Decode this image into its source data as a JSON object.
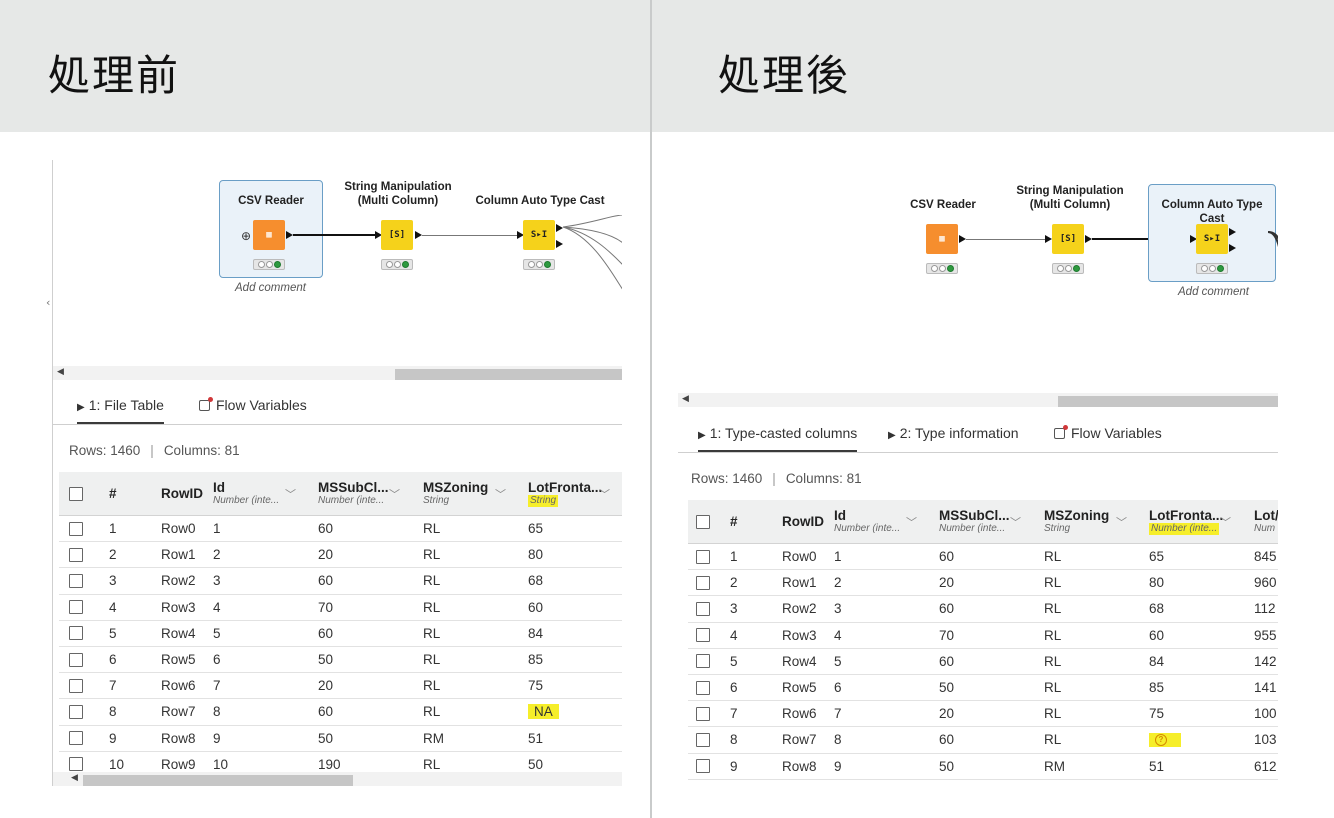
{
  "left": {
    "heading": "処理前",
    "nodes": {
      "csv_reader": "CSV Reader",
      "string_manip": "String Manipulation (Multi Column)",
      "auto_cast": "Column Auto Type Cast",
      "add_comment": "Add comment"
    },
    "tabs": [
      "1: File Table",
      "Flow Variables"
    ],
    "rows_label": "Rows: 1460",
    "cols_label": "Columns: 81",
    "headers": {
      "num": "#",
      "rowid": "RowID",
      "cols": [
        {
          "name": "Id",
          "type": "Number (inte..."
        },
        {
          "name": "MSSubCl...",
          "type": "Number (inte..."
        },
        {
          "name": "MSZoning",
          "type": "String"
        },
        {
          "name": "LotFronta...",
          "type": "String"
        }
      ]
    },
    "rows": [
      [
        "1",
        "Row0",
        "1",
        "60",
        "RL",
        "65"
      ],
      [
        "2",
        "Row1",
        "2",
        "20",
        "RL",
        "80"
      ],
      [
        "3",
        "Row2",
        "3",
        "60",
        "RL",
        "68"
      ],
      [
        "4",
        "Row3",
        "4",
        "70",
        "RL",
        "60"
      ],
      [
        "5",
        "Row4",
        "5",
        "60",
        "RL",
        "84"
      ],
      [
        "6",
        "Row5",
        "6",
        "50",
        "RL",
        "85"
      ],
      [
        "7",
        "Row6",
        "7",
        "20",
        "RL",
        "75"
      ],
      [
        "8",
        "Row7",
        "8",
        "60",
        "RL",
        "NA"
      ],
      [
        "9",
        "Row8",
        "9",
        "50",
        "RM",
        "51"
      ],
      [
        "10",
        "Row9",
        "10",
        "190",
        "RL",
        "50"
      ]
    ]
  },
  "right": {
    "heading": "処理後",
    "nodes": {
      "csv_reader": "CSV Reader",
      "string_manip": "String Manipulation (Multi Column)",
      "auto_cast": "Column Auto Type Cast",
      "add_comment": "Add comment"
    },
    "tabs": [
      "1: Type-casted columns",
      "2: Type information",
      "Flow Variables"
    ],
    "rows_label": "Rows: 1460",
    "cols_label": "Columns: 81",
    "headers": {
      "num": "#",
      "rowid": "RowID",
      "cols": [
        {
          "name": "Id",
          "type": "Number (inte..."
        },
        {
          "name": "MSSubCl...",
          "type": "Number (inte..."
        },
        {
          "name": "MSZoning",
          "type": "String"
        },
        {
          "name": "LotFronta...",
          "type": "Number (inte..."
        },
        {
          "name": "Lot/",
          "type": "Num"
        }
      ]
    },
    "rows": [
      [
        "1",
        "Row0",
        "1",
        "60",
        "RL",
        "65",
        "845"
      ],
      [
        "2",
        "Row1",
        "2",
        "20",
        "RL",
        "80",
        "960"
      ],
      [
        "3",
        "Row2",
        "3",
        "60",
        "RL",
        "68",
        "112"
      ],
      [
        "4",
        "Row3",
        "4",
        "70",
        "RL",
        "60",
        "955"
      ],
      [
        "5",
        "Row4",
        "5",
        "60",
        "RL",
        "84",
        "142"
      ],
      [
        "6",
        "Row5",
        "6",
        "50",
        "RL",
        "85",
        "141"
      ],
      [
        "7",
        "Row6",
        "7",
        "20",
        "RL",
        "75",
        "100"
      ],
      [
        "8",
        "Row7",
        "8",
        "60",
        "RL",
        "",
        "103"
      ],
      [
        "9",
        "Row8",
        "9",
        "50",
        "RM",
        "51",
        "612"
      ]
    ]
  },
  "colors": {
    "highlight": "#f6ee2a",
    "node_orange": "#f68e2e",
    "node_yellow": "#f5d21b",
    "header_bg": "#e6e8e7"
  }
}
